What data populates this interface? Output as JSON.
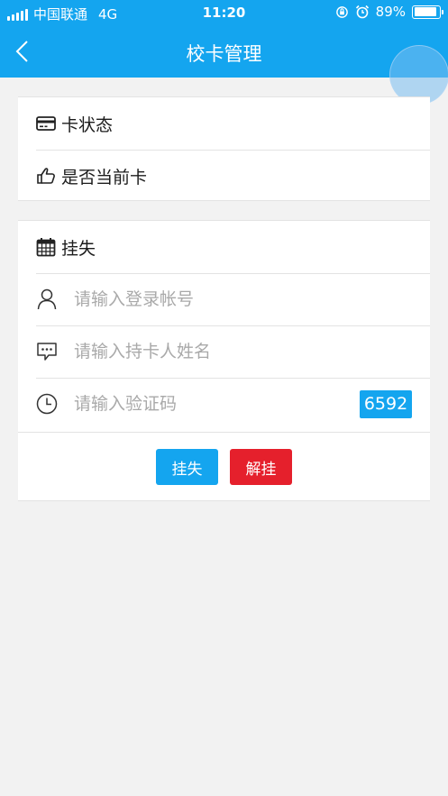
{
  "status_bar": {
    "carrier": "中国联通",
    "network": "4G",
    "time": "11:20",
    "battery_percent": "89%",
    "battery_level": 0.89
  },
  "header": {
    "title": "校卡管理",
    "background": "#14a5ef"
  },
  "card_info": {
    "status_label": "卡状态",
    "current_label": "是否当前卡"
  },
  "report_loss": {
    "section_label": "挂失",
    "account_placeholder": "请输入登录帐号",
    "name_placeholder": "请输入持卡人姓名",
    "code_placeholder": "请输入验证码",
    "captcha": "6592"
  },
  "buttons": {
    "report_label": "挂失",
    "report_color": "#14a5ef",
    "unreport_label": "解挂",
    "unreport_color": "#e5202c"
  },
  "icons": {
    "back": "chevron-left-icon",
    "card": "credit-card-icon",
    "current": "thumbs-up-icon",
    "calendar": "calendar-icon",
    "user": "user-icon",
    "message": "chat-bubble-icon",
    "clock": "clock-icon"
  }
}
